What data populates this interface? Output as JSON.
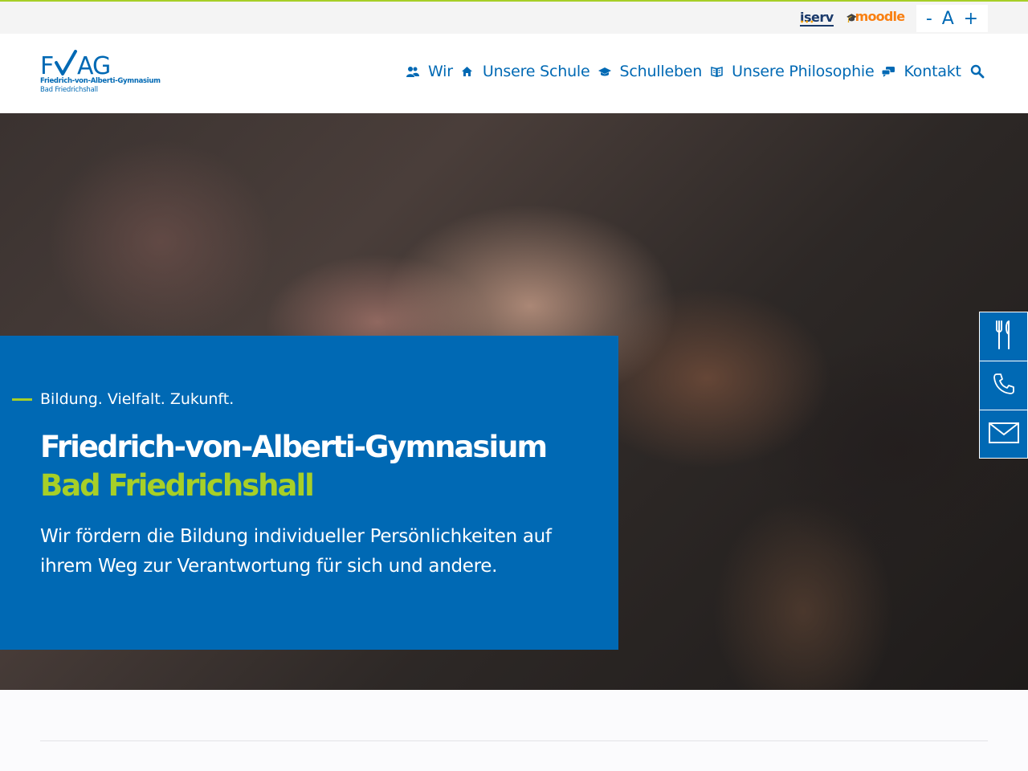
{
  "topbar": {
    "iserv_label": "iserv",
    "moodle_label": "moodle",
    "font_size": {
      "decrease": "-",
      "reset": "A",
      "increase": "+"
    }
  },
  "logo": {
    "mark": "FVAG",
    "line1": "Friedrich-von-Alberti-Gymnasium",
    "line2": "Bad Friedrichshall"
  },
  "nav": {
    "items": [
      {
        "label": "Wir",
        "icon": "users-icon"
      },
      {
        "label": "Unsere Schule",
        "icon": "home-icon"
      },
      {
        "label": "Schulleben",
        "icon": "graduation-cap-icon"
      },
      {
        "label": "Unsere Philosophie",
        "icon": "book-icon"
      },
      {
        "label": "Kontakt",
        "icon": "chat-bubbles-icon"
      }
    ],
    "search_icon": "search-icon"
  },
  "hero": {
    "tagline": "Bildung. Vielfalt. Zukunft.",
    "title": "Friedrich-von-Alberti-Gymnasium",
    "subtitle": "Bad Friedrichshall",
    "text": "Wir fördern die Bildung individueller Persönlichkeiten auf ihrem Weg zur Verantwortung für sich und andere."
  },
  "side_buttons": [
    {
      "icon": "fork-knife-icon"
    },
    {
      "icon": "phone-icon"
    },
    {
      "icon": "mail-icon"
    }
  ],
  "colors": {
    "primary": "#0069b4",
    "accent": "#a7cf27",
    "topbar_bg": "#f4f4f4"
  }
}
